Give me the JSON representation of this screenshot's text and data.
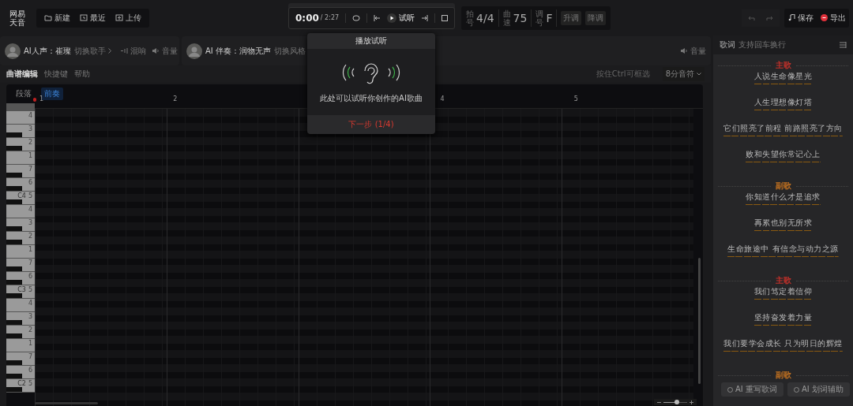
{
  "logo": {
    "text": "网易天音"
  },
  "toolbar": [
    {
      "label": "新建",
      "kind": "new"
    },
    {
      "label": "最近",
      "kind": "recent"
    },
    {
      "label": "上传",
      "kind": "upload"
    }
  ],
  "transport": {
    "time": "0:00",
    "duration": "/ 2:27",
    "play_label": "试听"
  },
  "meter": [
    {
      "label": "拍号",
      "value": "4/4"
    },
    {
      "label": "曲速",
      "value": "75"
    },
    {
      "label": "调号",
      "value": "F"
    }
  ],
  "key_buttons": [
    "升调",
    "降调"
  ],
  "actions": {
    "save": "保存",
    "export": "导出"
  },
  "tracks": [
    {
      "title": "AI人声：崔璨",
      "switch": "切换歌手",
      "controls": [
        {
          "label": "混响",
          "kind": "reverb"
        },
        {
          "label": "音量",
          "kind": "volume"
        }
      ]
    },
    {
      "title": "AI 伴奏：润物无声",
      "switch": "切换风格",
      "controls": [
        {
          "label": "音量",
          "kind": "volume"
        }
      ]
    }
  ],
  "editor_menu": [
    {
      "label": "曲谱编辑",
      "selected": true
    },
    {
      "label": "快捷键",
      "selected": false
    },
    {
      "label": "帮助",
      "selected": false
    }
  ],
  "hint": "按住Ctrl可框选",
  "note_value": "8分音符",
  "section_tabs": [
    {
      "label": "段落",
      "selected": false
    },
    {
      "label": "前奏",
      "selected": true
    }
  ],
  "measures": [
    {
      "label": "1"
    },
    {
      "label": "2"
    },
    {
      "covered": true
    },
    {
      "label": "4"
    },
    {
      "label": "5"
    }
  ],
  "zoom": {
    "level": 0.55
  },
  "keys": [
    {
      "label": "4",
      "black_below": false
    },
    {
      "label": "3",
      "black_below": true
    },
    {
      "label": "2",
      "black_below": true
    },
    {
      "label": "1",
      "black_below": false
    },
    {
      "label": "7",
      "black_below": true
    },
    {
      "label": "6",
      "black_below": true
    },
    {
      "label": "5",
      "octave": "C4",
      "black_below": true
    },
    {
      "label": "4",
      "black_below": false
    },
    {
      "label": "3",
      "black_below": true
    },
    {
      "label": "2",
      "black_below": true
    },
    {
      "label": "1",
      "black_below": false
    },
    {
      "label": "7",
      "black_below": true
    },
    {
      "label": "6",
      "black_below": true
    },
    {
      "label": "5",
      "octave": "C3",
      "black_below": true
    },
    {
      "label": "4",
      "black_below": false
    },
    {
      "label": "3",
      "black_below": true
    },
    {
      "label": "2",
      "black_below": true
    },
    {
      "label": "1",
      "black_below": false
    },
    {
      "label": "7",
      "black_below": true
    },
    {
      "label": "6",
      "black_below": true
    },
    {
      "label": "5",
      "octave": "C2",
      "black_below": true
    }
  ],
  "lyrics": {
    "title": "歌词",
    "hint": "支持回车换行",
    "sections": [
      {
        "label": "主歌",
        "color": "#c0302a",
        "lines": [
          "人说生命像星光",
          "人生理想像灯塔",
          "它们照亮了前程 前路照亮了方向",
          "败和失望你常记心上"
        ]
      },
      {
        "label": "副歌",
        "color": "#c07020",
        "lines": [
          "你知道什么才是追求",
          "再累也别无所求",
          "生命旅途中 有信念与动力之源"
        ]
      },
      {
        "label": "主歌",
        "color": "#c0302a",
        "lines": [
          "我们笃定着信仰",
          "坚持奋发着力量",
          "我们要学会成长 只为明日的辉煌"
        ]
      },
      {
        "label": "副歌",
        "color": "#c07020"
      }
    ],
    "buttons": [
      "AI 重写歌词",
      "AI 划词辅助"
    ]
  },
  "tour": {
    "title": "播放试听",
    "text": "此处可以试听你创作的AI歌曲",
    "next": "下一步 (1/4)"
  }
}
